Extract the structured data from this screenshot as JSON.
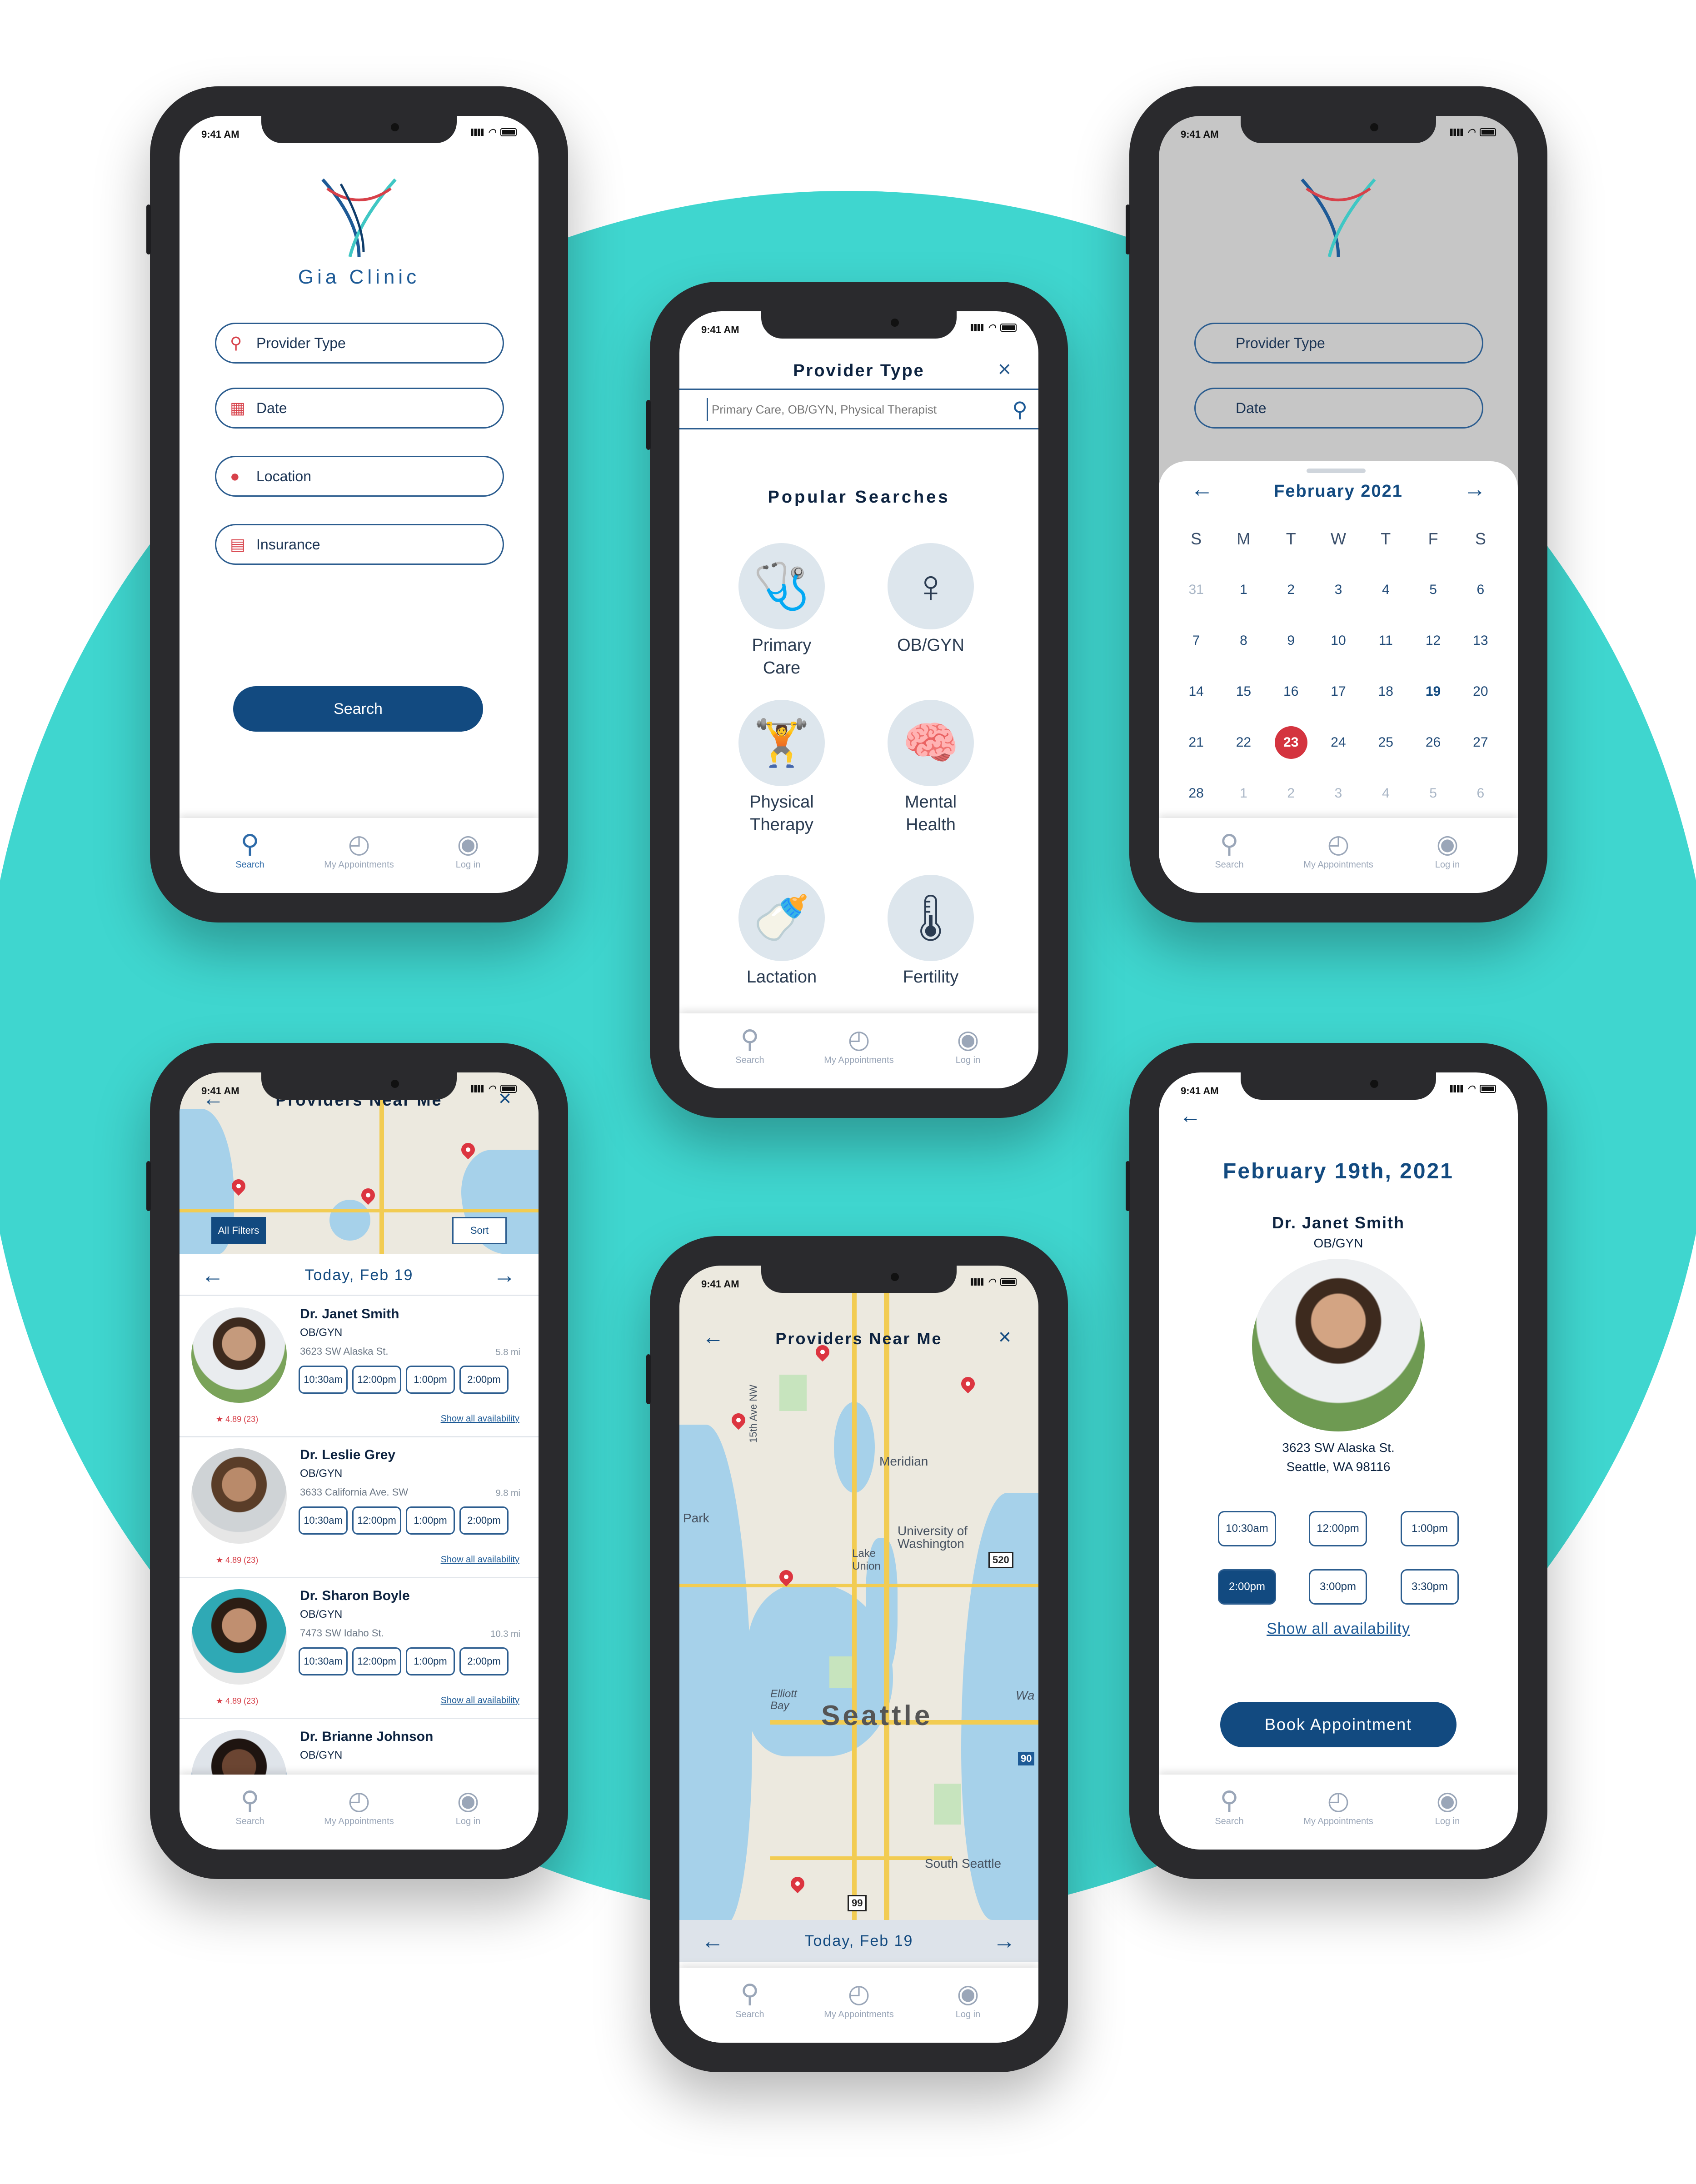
{
  "status_time": "9:41 AM",
  "tabs": {
    "search": "Search",
    "appointments": "My Appointments",
    "login": "Log in"
  },
  "s1": {
    "clinic_name": "Gia Clinic",
    "fields": [
      "Provider Type",
      "Date",
      "Location",
      "Insurance"
    ],
    "search_button": "Search"
  },
  "s2": {
    "title": "Provider Type",
    "placeholder": "Primary Care, OB/GYN, Physical Therapist",
    "popular": "Popular Searches",
    "cats": [
      "Primary Care",
      "OB/GYN",
      "Physical Therapy",
      "Mental Health",
      "Lactation",
      "Fertility"
    ]
  },
  "s3": {
    "fields": [
      "Provider Type",
      "Date"
    ],
    "month": "February 2021",
    "weekdays": [
      "S",
      "M",
      "T",
      "W",
      "T",
      "F",
      "S"
    ],
    "days": [
      "31",
      "1",
      "2",
      "3",
      "4",
      "5",
      "6",
      "7",
      "8",
      "9",
      "10",
      "11",
      "12",
      "13",
      "14",
      "15",
      "16",
      "17",
      "18",
      "19",
      "20",
      "21",
      "22",
      "23",
      "24",
      "25",
      "26",
      "27",
      "28",
      "1",
      "2",
      "3",
      "4",
      "5",
      "6"
    ],
    "today": "19",
    "selected": "23"
  },
  "s4": {
    "title": "Providers Near Me",
    "filters": "All Filters",
    "sort": "Sort",
    "date": "Today, Feb 19",
    "providers": [
      {
        "name": "Dr. Janet Smith",
        "spec": "OB/GYN",
        "addr": "3623 SW Alaska St.",
        "dist": "5.8 mi",
        "rating": "★ 4.89 (23)"
      },
      {
        "name": "Dr. Leslie Grey",
        "spec": "OB/GYN",
        "addr": "3633 California Ave. SW",
        "dist": "9.8 mi",
        "rating": "★ 4.89 (23)"
      },
      {
        "name": "Dr. Sharon Boyle",
        "spec": "OB/GYN",
        "addr": "7473 SW Idaho St.",
        "dist": "10.3 mi",
        "rating": "★ 4.89 (23)"
      },
      {
        "name": "Dr. Brianne Johnson",
        "spec": "OB/GYN",
        "addr": "",
        "dist": "",
        "rating": ""
      }
    ],
    "slots": [
      "10:30am",
      "12:00pm",
      "1:00pm",
      "2:00pm"
    ],
    "show_all": "Show all availability"
  },
  "s5": {
    "title": "Providers Near Me",
    "labels": {
      "meridian": "Meridian",
      "uw": "University of Washington",
      "lake": "Lake Union",
      "park": "Park",
      "elliott": "Elliott Bay",
      "seattle": "Seattle",
      "south": "South Seattle",
      "ave": "15th Ave NW",
      "r520": "520",
      "r99": "99",
      "r90": "90",
      "wa": "Wa"
    },
    "date": "Today, Feb 19"
  },
  "s6": {
    "date_title": "February 19th, 2021",
    "name": "Dr. Janet Smith",
    "spec": "OB/GYN",
    "addr1": "3623 SW Alaska St.",
    "addr2": "Seattle, WA 98116",
    "slots": [
      "10:30am",
      "12:00pm",
      "1:00pm",
      "2:00pm",
      "3:00pm",
      "3:30pm"
    ],
    "show_all": "Show all availability",
    "book": "Book Appointment"
  },
  "colors": {
    "teal": "#3fd6cf",
    "navy": "#124a80",
    "red": "#d4343f"
  }
}
